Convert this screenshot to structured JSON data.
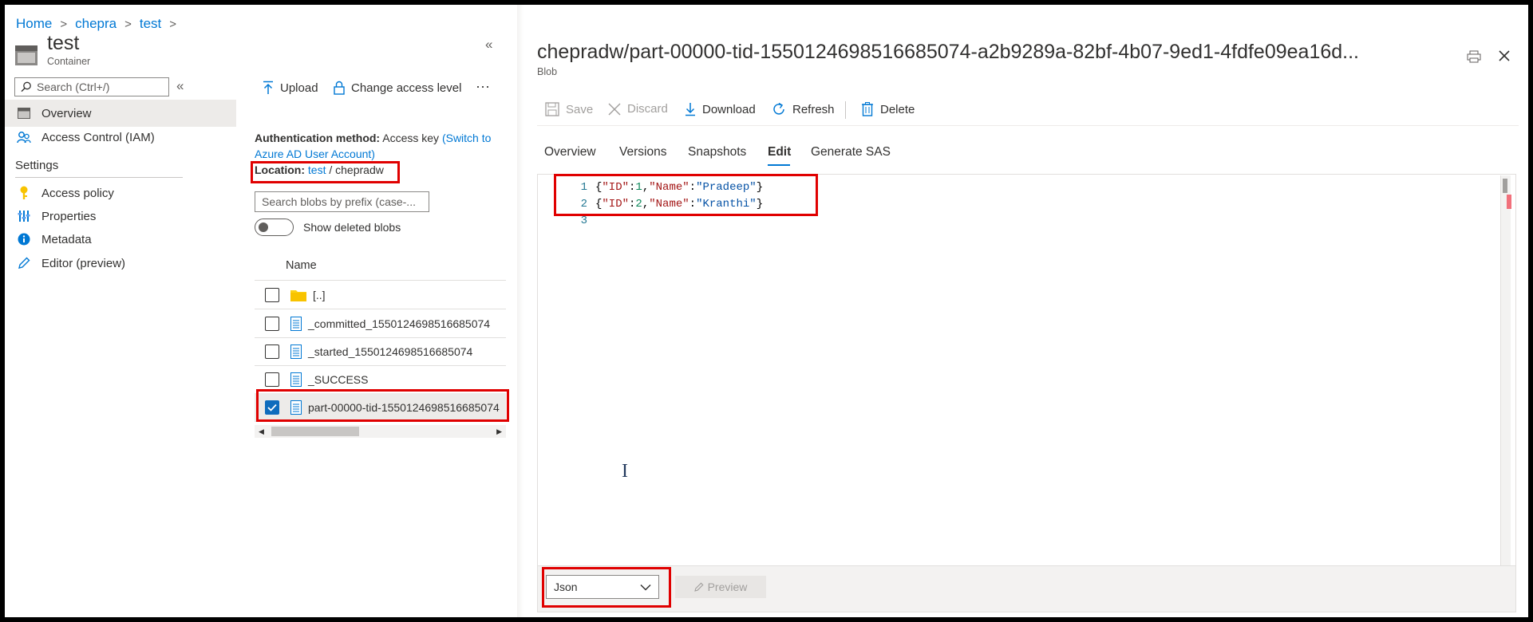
{
  "breadcrumb": [
    "Home",
    "chepra",
    "test"
  ],
  "container": {
    "title": "test",
    "subtitle": "Container"
  },
  "left_nav": {
    "search_placeholder": "Search (Ctrl+/)",
    "items": [
      {
        "label": "Overview",
        "icon": "overview-icon",
        "selected": true
      },
      {
        "label": "Access Control (IAM)",
        "icon": "people-icon",
        "selected": false
      }
    ],
    "settings_header": "Settings",
    "settings_items": [
      {
        "label": "Access policy",
        "icon": "key-icon"
      },
      {
        "label": "Properties",
        "icon": "properties-icon"
      },
      {
        "label": "Metadata",
        "icon": "info-icon"
      },
      {
        "label": "Editor (preview)",
        "icon": "pencil-icon"
      }
    ]
  },
  "middle": {
    "toolbar": {
      "upload": "Upload",
      "change_access": "Change access level",
      "more": "···"
    },
    "auth": {
      "label": "Authentication method:",
      "value": "Access key",
      "switch_link_1": "(Switch to",
      "switch_link_2": "Azure AD User Account)"
    },
    "location": {
      "label": "Location:",
      "container": "test",
      "sep": "/",
      "folder": "chepradw"
    },
    "search_placeholder": "Search blobs by prefix (case-...",
    "show_deleted": "Show deleted blobs",
    "name_header": "Name",
    "rows": [
      {
        "name": "[..]",
        "type": "folder",
        "checked": false
      },
      {
        "name": "_committed_1550124698516685074",
        "type": "file",
        "checked": false
      },
      {
        "name": "_started_1550124698516685074",
        "type": "file",
        "checked": false
      },
      {
        "name": "_SUCCESS",
        "type": "file",
        "checked": false
      },
      {
        "name": "part-00000-tid-1550124698516685074",
        "type": "file",
        "checked": true
      }
    ]
  },
  "blob": {
    "title": "chepradw/part-00000-tid-1550124698516685074-a2b9289a-82bf-4b07-9ed1-4fdfe09ea16d...",
    "subtitle": "Blob",
    "toolbar": {
      "save": "Save",
      "discard": "Discard",
      "download": "Download",
      "refresh": "Refresh",
      "delete": "Delete"
    },
    "tabs": [
      "Overview",
      "Versions",
      "Snapshots",
      "Edit",
      "Generate SAS"
    ],
    "active_tab": "Edit",
    "editor": {
      "line_numbers": [
        "1",
        "2",
        "3"
      ],
      "lines": [
        {
          "open": "{",
          "key1": "\"ID\"",
          "colon1": ":",
          "val1": "1",
          "comma": ",",
          "key2": "\"Name\"",
          "colon2": ":",
          "val2": "\"Pradeep\"",
          "close": "}"
        },
        {
          "open": "{",
          "key1": "\"ID\"",
          "colon1": ":",
          "val1": "2",
          "comma": ",",
          "key2": "\"Name\"",
          "colon2": ":",
          "val2": "\"Kranthi\"",
          "close": "}"
        }
      ]
    },
    "format_select": "Json",
    "preview_button": "Preview"
  },
  "colors": {
    "accent": "#0078d4",
    "highlight": "#e00000",
    "selected_nav": "#edebe9"
  }
}
